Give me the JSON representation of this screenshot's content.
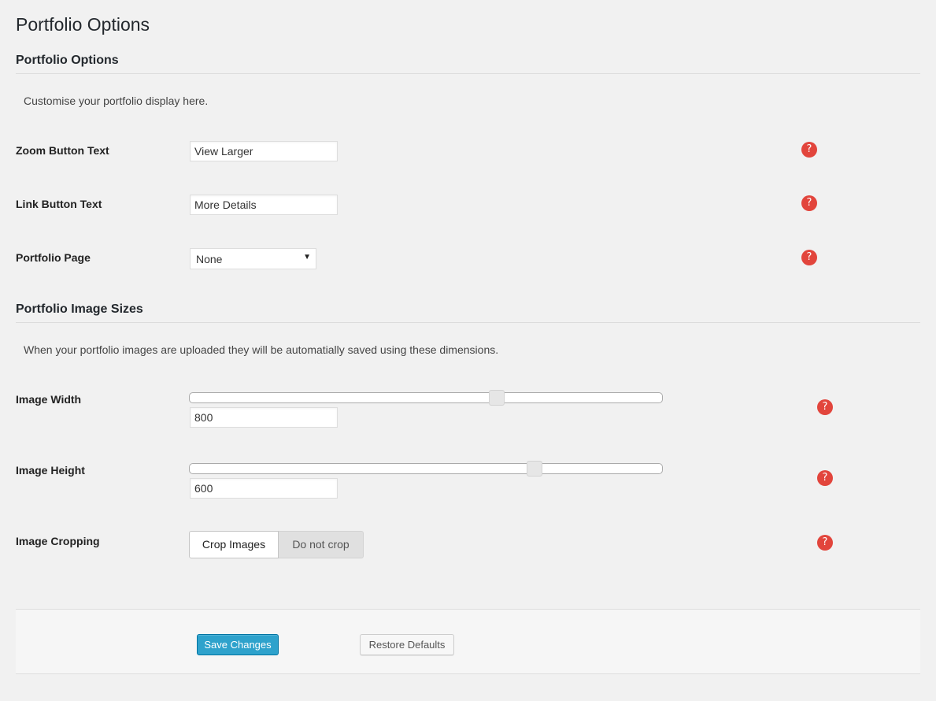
{
  "page": {
    "title": "Portfolio Options"
  },
  "sections": {
    "portfolio_options": {
      "heading": "Portfolio Options",
      "description": "Customise your portfolio display here.",
      "fields": {
        "zoom_button_text": {
          "label": "Zoom Button Text",
          "value": "View Larger"
        },
        "link_button_text": {
          "label": "Link Button Text",
          "value": "More Details"
        },
        "portfolio_page": {
          "label": "Portfolio Page",
          "selected": "None",
          "arrow": "▼"
        }
      }
    },
    "image_sizes": {
      "heading": "Portfolio Image Sizes",
      "description": "When your portfolio images are uploaded they will be automatially saved using these dimensions.",
      "fields": {
        "image_width": {
          "label": "Image Width",
          "value": "800",
          "slider_fraction": 0.65
        },
        "image_height": {
          "label": "Image Height",
          "value": "600",
          "slider_fraction": 0.73
        },
        "image_cropping": {
          "label": "Image Cropping",
          "options": [
            "Crop Images",
            "Do not crop"
          ],
          "selected": "Crop Images"
        }
      }
    }
  },
  "help_icon": {
    "glyph": "?",
    "icon": "help-icon",
    "color": "#e2453c"
  },
  "footer": {
    "save_label": "Save Changes",
    "restore_label": "Restore Defaults"
  },
  "colors": {
    "background": "#f1f1f1",
    "primary_button": "#2ea2cc",
    "help_icon": "#e2453c"
  }
}
